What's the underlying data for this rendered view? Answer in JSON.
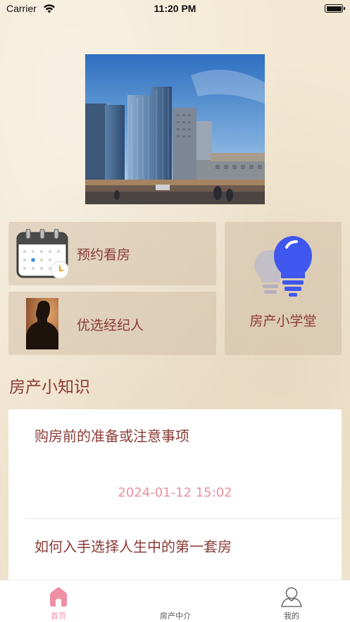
{
  "status_bar": {
    "carrier": "Carrier",
    "time": "11:20 PM"
  },
  "quick_links": {
    "appointment": {
      "label": "预约看房",
      "icon": "calendar-icon"
    },
    "agent": {
      "label": "优选经纪人",
      "icon": "agent-photo"
    },
    "school": {
      "label": "房产小学堂",
      "icon": "lightbulb-icon"
    }
  },
  "knowledge": {
    "title": "房产小知识",
    "articles": [
      {
        "title": "购房前的准备或注意事项",
        "date": "2024-01-12 15:02"
      },
      {
        "title": "如何入手选择人生中的第一套房"
      }
    ]
  },
  "tab_bar": {
    "tabs": [
      {
        "label": "首页",
        "icon": "home-icon"
      },
      {
        "label": "房产中介",
        "icon": "agency-icon"
      },
      {
        "label": "我的",
        "icon": "profile-icon"
      }
    ]
  },
  "colors": {
    "accent": "#8a3b35",
    "date": "#ee8fa3",
    "active_tab": "#ee8fa3",
    "background": "#f3e8d3"
  }
}
